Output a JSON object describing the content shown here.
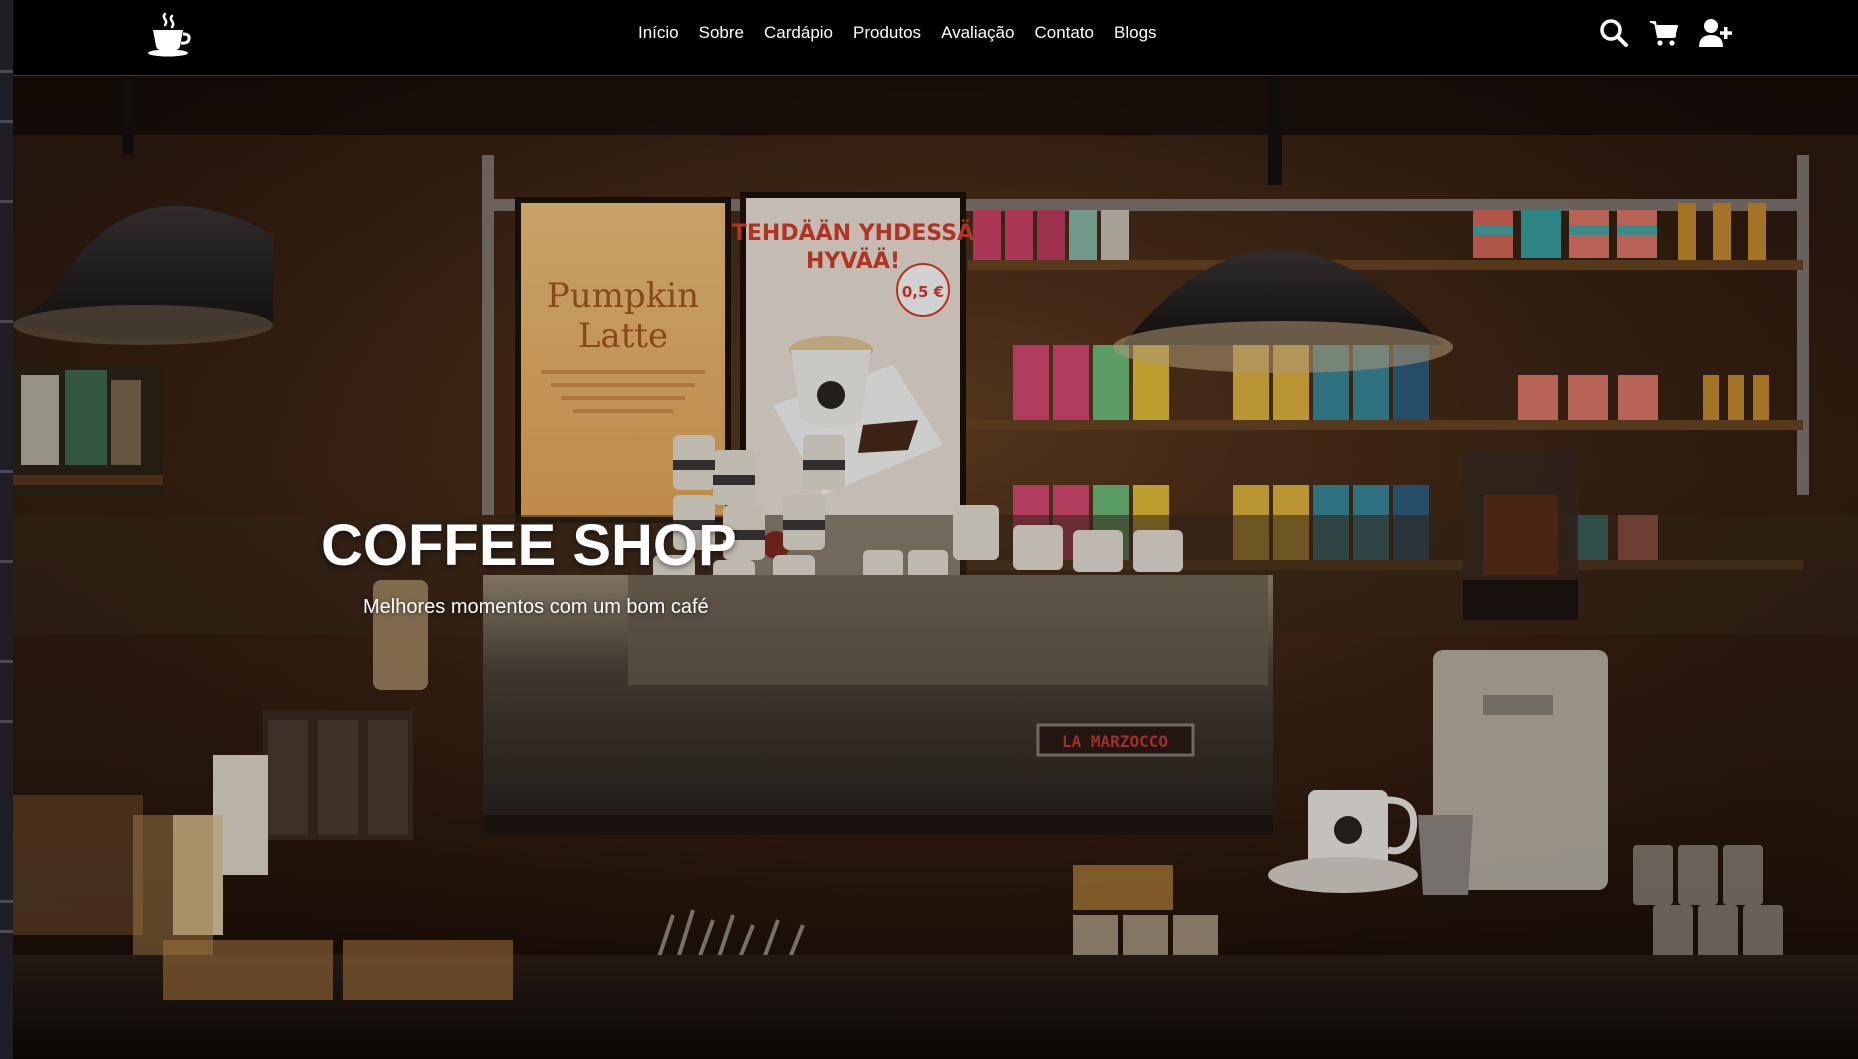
{
  "nav": {
    "logo_icon": "coffee-cup-icon",
    "links": [
      "Início",
      "Sobre",
      "Cardápio",
      "Produtos",
      "Avaliação",
      "Contato",
      "Blogs"
    ],
    "icons": [
      "search-icon",
      "cart-icon",
      "user-plus-icon"
    ]
  },
  "hero": {
    "title": "COFFEE SHOP",
    "subtitle": "Melhores momentos com um bom café",
    "background": "coffee-shop-counter-photo"
  },
  "photo_signs": {
    "pumpkin_title_1": "Pumpkin",
    "pumpkin_title_2": "Latte",
    "poster_headline_1": "TEHDÄÄN YHDESSÄ",
    "poster_headline_2": "HYVÄÄ!",
    "poster_price": "0,5 €",
    "machine_brand": "LA MARZOCCO"
  },
  "colors": {
    "navbar_bg": "#000000",
    "nav_text": "#ffffff",
    "hero_text": "#ffffff"
  }
}
